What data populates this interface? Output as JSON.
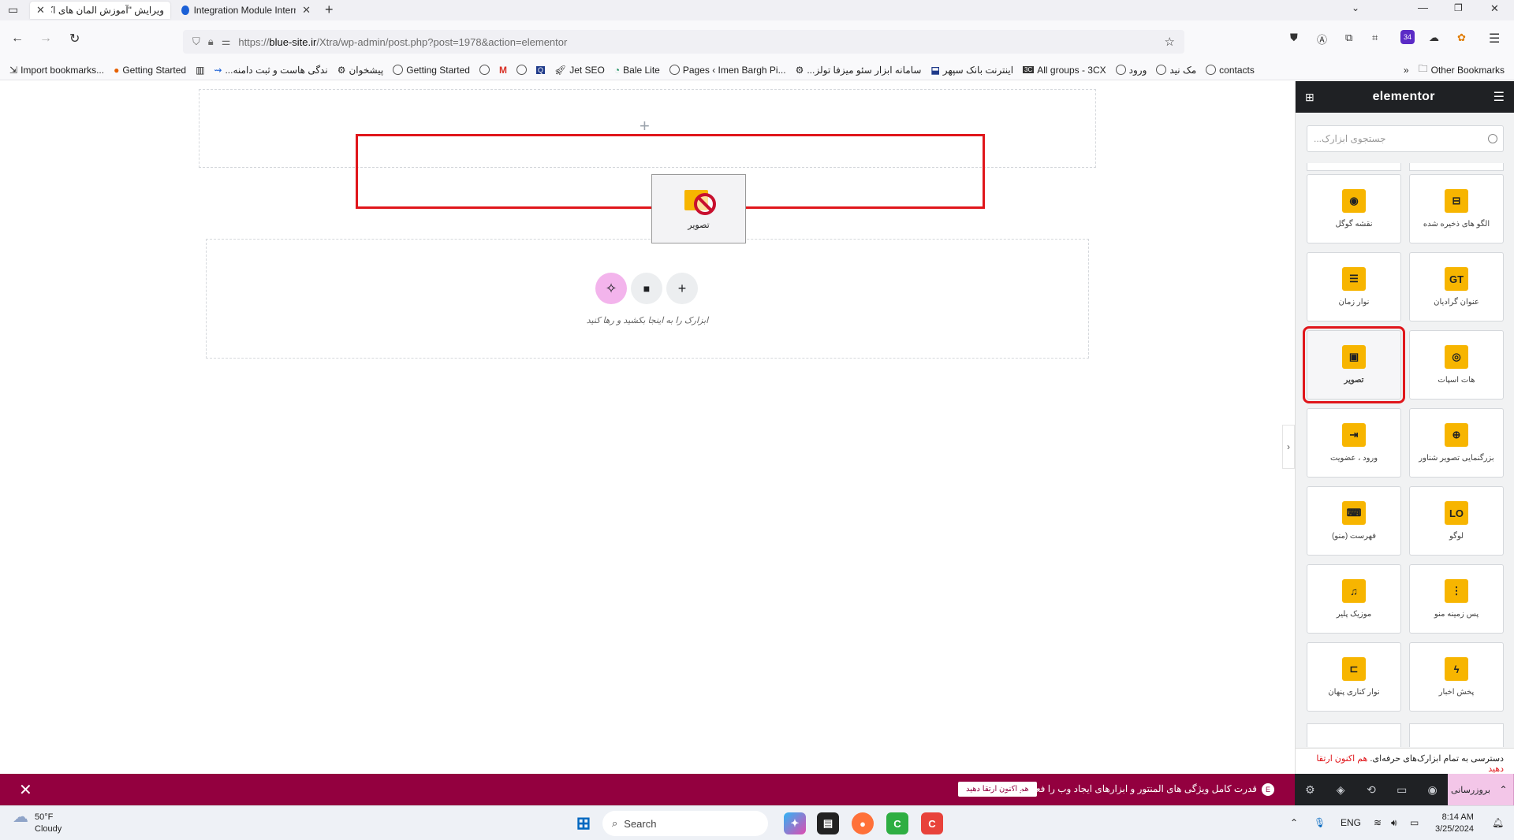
{
  "browser": {
    "tabs": [
      {
        "label": "ویرایش \"آموزش المان های اکسترا ـ..."
      },
      {
        "label": "Integration Module Internet Do"
      }
    ],
    "url_prefix": "https://",
    "url_domain": "blue-site.ir",
    "url_path": "/Xtra/wp-admin/post.php?post=1978&action=elementor",
    "bookmarks": [
      "Import bookmarks...",
      "Getting Started",
      "...ندگی هاست و ثبت دامنه",
      "پیشخوان",
      "Getting Started",
      "Jet SEO",
      "Bale Lite",
      "Pages ‹ Imen Bargh Pi...",
      "...سامانه ابزار سئو میزفا تولز",
      "اینترنت بانک سپهر",
      "All groups - 3CX",
      "ورود",
      "مک نید",
      "contacts"
    ],
    "other_bookmarks": "Other Bookmarks",
    "notif_count": "34"
  },
  "canvas": {
    "drag_label": "تصویر",
    "drop_hint": "ابزارک را به اینجا بکشید و رها کنید"
  },
  "panel": {
    "brand": "elementor",
    "search_placeholder": "جستجوی ابزارک...",
    "widgets": [
      {
        "label": "الگو های ذخیره شده",
        "icon": "saved-templates-icon",
        "glyph": "⊟"
      },
      {
        "label": "نقشه گوگل",
        "icon": "map-pin-icon",
        "glyph": "◉"
      },
      {
        "label": "عنوان گرادیان",
        "icon": "gradient-title-icon",
        "glyph": "GT"
      },
      {
        "label": "نوار زمان",
        "icon": "timeline-icon",
        "glyph": "☰"
      },
      {
        "label": "هات اسپات",
        "icon": "hotspot-icon",
        "glyph": "◎"
      },
      {
        "label": "تصویر",
        "icon": "image-icon",
        "glyph": "▣"
      },
      {
        "label": "بزرگنمایی تصویر شناور",
        "icon": "image-zoom-icon",
        "glyph": "⊕"
      },
      {
        "label": "ورود ، عضویت",
        "icon": "login-icon",
        "glyph": "⇥"
      },
      {
        "label": "لوگو",
        "icon": "logo-icon",
        "glyph": "LO"
      },
      {
        "label": "فهرست (منو)",
        "icon": "nav-menu-icon",
        "glyph": "⌨"
      },
      {
        "label": "پس زمینه منو",
        "icon": "menu-background-icon",
        "glyph": "⋮"
      },
      {
        "label": "موزیک پلیر",
        "icon": "music-player-icon",
        "glyph": "♫"
      },
      {
        "label": "پخش اخبار",
        "icon": "news-ticker-icon",
        "glyph": "ϟ"
      },
      {
        "label": "نوار کناری پنهان",
        "icon": "hidden-sidebar-icon",
        "glyph": "⊐"
      }
    ],
    "promo_text": "دسترسی به تمام ابزارک‌های حرفه‌ای.",
    "promo_link": "هم اکنون ارتقا دهید",
    "update_label": "بروزرسانی"
  },
  "notice": {
    "text": "قدرت کامل ویژگی های المنتور و ابزارهای ایجاد وب را فعال کنید.",
    "button": "هم اکنون ارتقا دهید"
  },
  "taskbar": {
    "temp": "50°F",
    "condition": "Cloudy",
    "search": "Search",
    "lang": "ENG",
    "time": "8:14 AM",
    "date": "3/25/2024"
  },
  "colors": {
    "accent_red": "#e0161b",
    "notice_bg": "#93003f",
    "widget_icon_bg": "#f7b500",
    "panel_header": "#1f2124"
  }
}
